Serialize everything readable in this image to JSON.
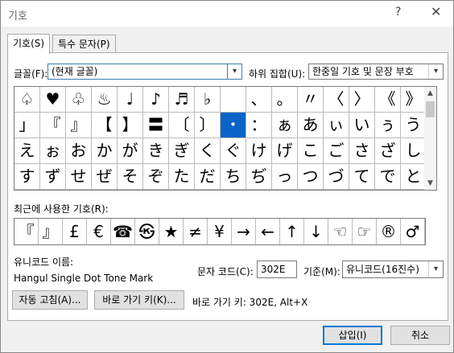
{
  "window": {
    "title": "기호",
    "help": "?",
    "close": "✕"
  },
  "tabs": [
    {
      "label": "기호(S)"
    },
    {
      "label": "특수 문자(P)"
    }
  ],
  "font": {
    "label": "글꼴(F):",
    "value": "(현재 글꼴)"
  },
  "subset": {
    "label": "하위 집합(U):",
    "value": "한중일 기호 및 문장 부호"
  },
  "grid": {
    "rows": [
      [
        "♤",
        "♥",
        "♧",
        "♨",
        "♩",
        "♪",
        "♬",
        "♭",
        "",
        "、",
        "。",
        "〃",
        "〈",
        "〉",
        "《",
        "》",
        "「"
      ],
      [
        "」",
        "『",
        "』",
        "【",
        "】",
        "〓",
        "〔",
        "〕",
        "・",
        "：",
        "ぁ",
        "あ",
        "ぃ",
        "い",
        "ぅ",
        "う",
        "ぇ"
      ],
      [
        "え",
        "ぉ",
        "お",
        "か",
        "が",
        "き",
        "ぎ",
        "く",
        "ぐ",
        "け",
        "げ",
        "こ",
        "ご",
        "さ",
        "ざ",
        "し",
        "じ"
      ],
      [
        "す",
        "ず",
        "せ",
        "ぜ",
        "そ",
        "ぞ",
        "た",
        "だ",
        "ち",
        "ぢ",
        "っ",
        "つ",
        "づ",
        "て",
        "で",
        "と",
        "ど"
      ]
    ],
    "selected_row": 1,
    "selected_col": 8
  },
  "recent": {
    "label": "최근에 사용한 기호(R):",
    "symbols": [
      "『",
      "』",
      "£",
      "€",
      "☎",
      "㉿",
      "★",
      "≠",
      "¥",
      "→",
      "←",
      "↑",
      "↓",
      "☜",
      "☞",
      "®",
      "♂"
    ]
  },
  "unicode_name": {
    "label": "유니코드 이름:",
    "value": "Hangul Single Dot Tone Mark"
  },
  "char_code": {
    "label": "문자 코드(C):",
    "value": "302E"
  },
  "base": {
    "label": "기준(M):",
    "value": "유니코드(16진수)"
  },
  "buttons": {
    "autocorrect": "자동 고침(A)...",
    "shortcut": "바로 가기 키(K)...",
    "insert": "삽입(I)",
    "cancel": "취소"
  },
  "shortcut_text": "바로 가기 키: 302E, Alt+X",
  "scroll": {
    "up": "▲",
    "down": "▼"
  },
  "combo_arrow": "▾"
}
